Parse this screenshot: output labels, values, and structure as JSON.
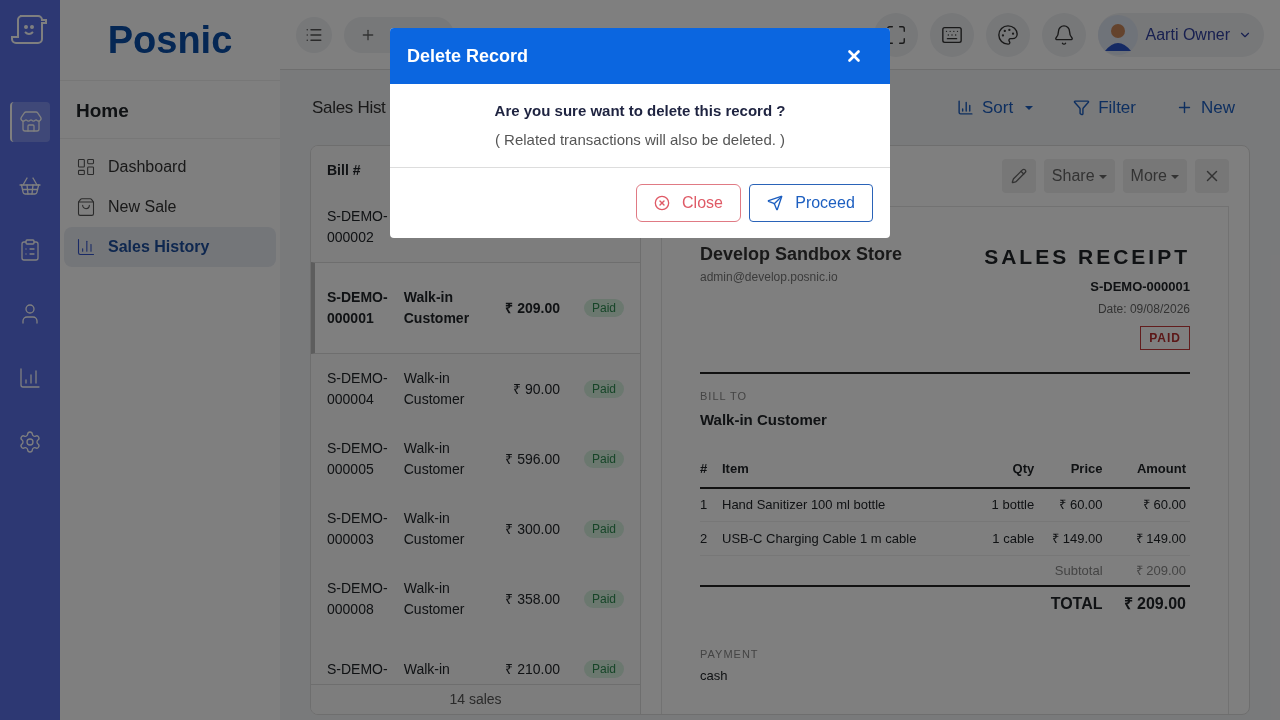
{
  "rail": {
    "items": [
      {
        "kind": "store",
        "selected": true
      },
      {
        "kind": "basket",
        "selected": false
      },
      {
        "kind": "clipboard",
        "selected": false
      },
      {
        "kind": "user",
        "selected": false
      },
      {
        "kind": "chart",
        "selected": false
      },
      {
        "kind": "settings",
        "selected": false
      }
    ]
  },
  "brand": "Posnic",
  "sidebar": {
    "heading": "Home",
    "items": [
      {
        "kind": "dashboard",
        "label": "Dashboard",
        "selected": false
      },
      {
        "kind": "bag",
        "label": "New Sale",
        "selected": false
      },
      {
        "kind": "history",
        "label": "Sales History",
        "selected": true
      }
    ]
  },
  "topbar": {
    "user": "Aarti Owner"
  },
  "page": {
    "title": "Sales Hist",
    "actions": [
      {
        "kind": "sort",
        "label": "Sort"
      },
      {
        "kind": "filter",
        "label": "Filter"
      },
      {
        "kind": "new",
        "label": "New"
      }
    ]
  },
  "sales_list": {
    "column": "Bill #",
    "rows": [
      {
        "bill": "S-DEMO-000002",
        "selected": false
      },
      {
        "bill": "S-DEMO-000001",
        "customer": "Walk-in Customer",
        "amount": "₹ 209.00",
        "status": "Paid",
        "selected": true
      },
      {
        "bill": "S-DEMO-000004",
        "customer": "Walk-in Customer",
        "amount": "₹ 90.00",
        "status": "Paid",
        "selected": false
      },
      {
        "bill": "S-DEMO-000005",
        "customer": "Walk-in Customer",
        "amount": "₹ 596.00",
        "status": "Paid",
        "selected": false
      },
      {
        "bill": "S-DEMO-000003",
        "customer": "Walk-in Customer",
        "amount": "₹ 300.00",
        "status": "Paid",
        "selected": false
      },
      {
        "bill": "S-DEMO-000008",
        "customer": "Walk-in Customer",
        "amount": "₹ 358.00",
        "status": "Paid",
        "selected": false
      },
      {
        "bill": "S-DEMO-",
        "customer": "Walk-in",
        "amount": "₹ 210.00",
        "status": "Paid",
        "selected": false
      }
    ],
    "footer": "14 sales"
  },
  "receipt": {
    "toolbar": [
      "Share",
      "More"
    ],
    "store_name": "Develop Sandbox Store",
    "store_email": "admin@develop.posnic.io",
    "title": "SALES RECEIPT",
    "number": "S-DEMO-000001",
    "date": "Date: 09/08/2026",
    "status": "PAID",
    "bill_to_label": "BILL TO",
    "customer": "Walk-in Customer",
    "columns": [
      "#",
      "Item",
      "Qty",
      "Price",
      "Amount"
    ],
    "rows": [
      [
        "1",
        "Hand Sanitizer 100 ml bottle",
        "1 bottle",
        "₹ 60.00",
        "₹ 60.00"
      ],
      [
        "2",
        "USB-C Charging Cable 1 m cable",
        "1 cable",
        "₹ 149.00",
        "₹ 149.00"
      ]
    ],
    "subtotal_label": "Subtotal",
    "subtotal": "₹ 209.00",
    "total_label": "TOTAL",
    "total": "₹ 209.00",
    "payment_label": "PAYMENT",
    "payment": "cash"
  },
  "dialog": {
    "title": "Delete Record",
    "message": "Are you sure want to delete this record ?",
    "note": "( Related transactions will also be deleted. )",
    "buttons": [
      {
        "kind": "cancel",
        "label": "Close"
      },
      {
        "kind": "confirm",
        "label": "Proceed"
      }
    ]
  }
}
